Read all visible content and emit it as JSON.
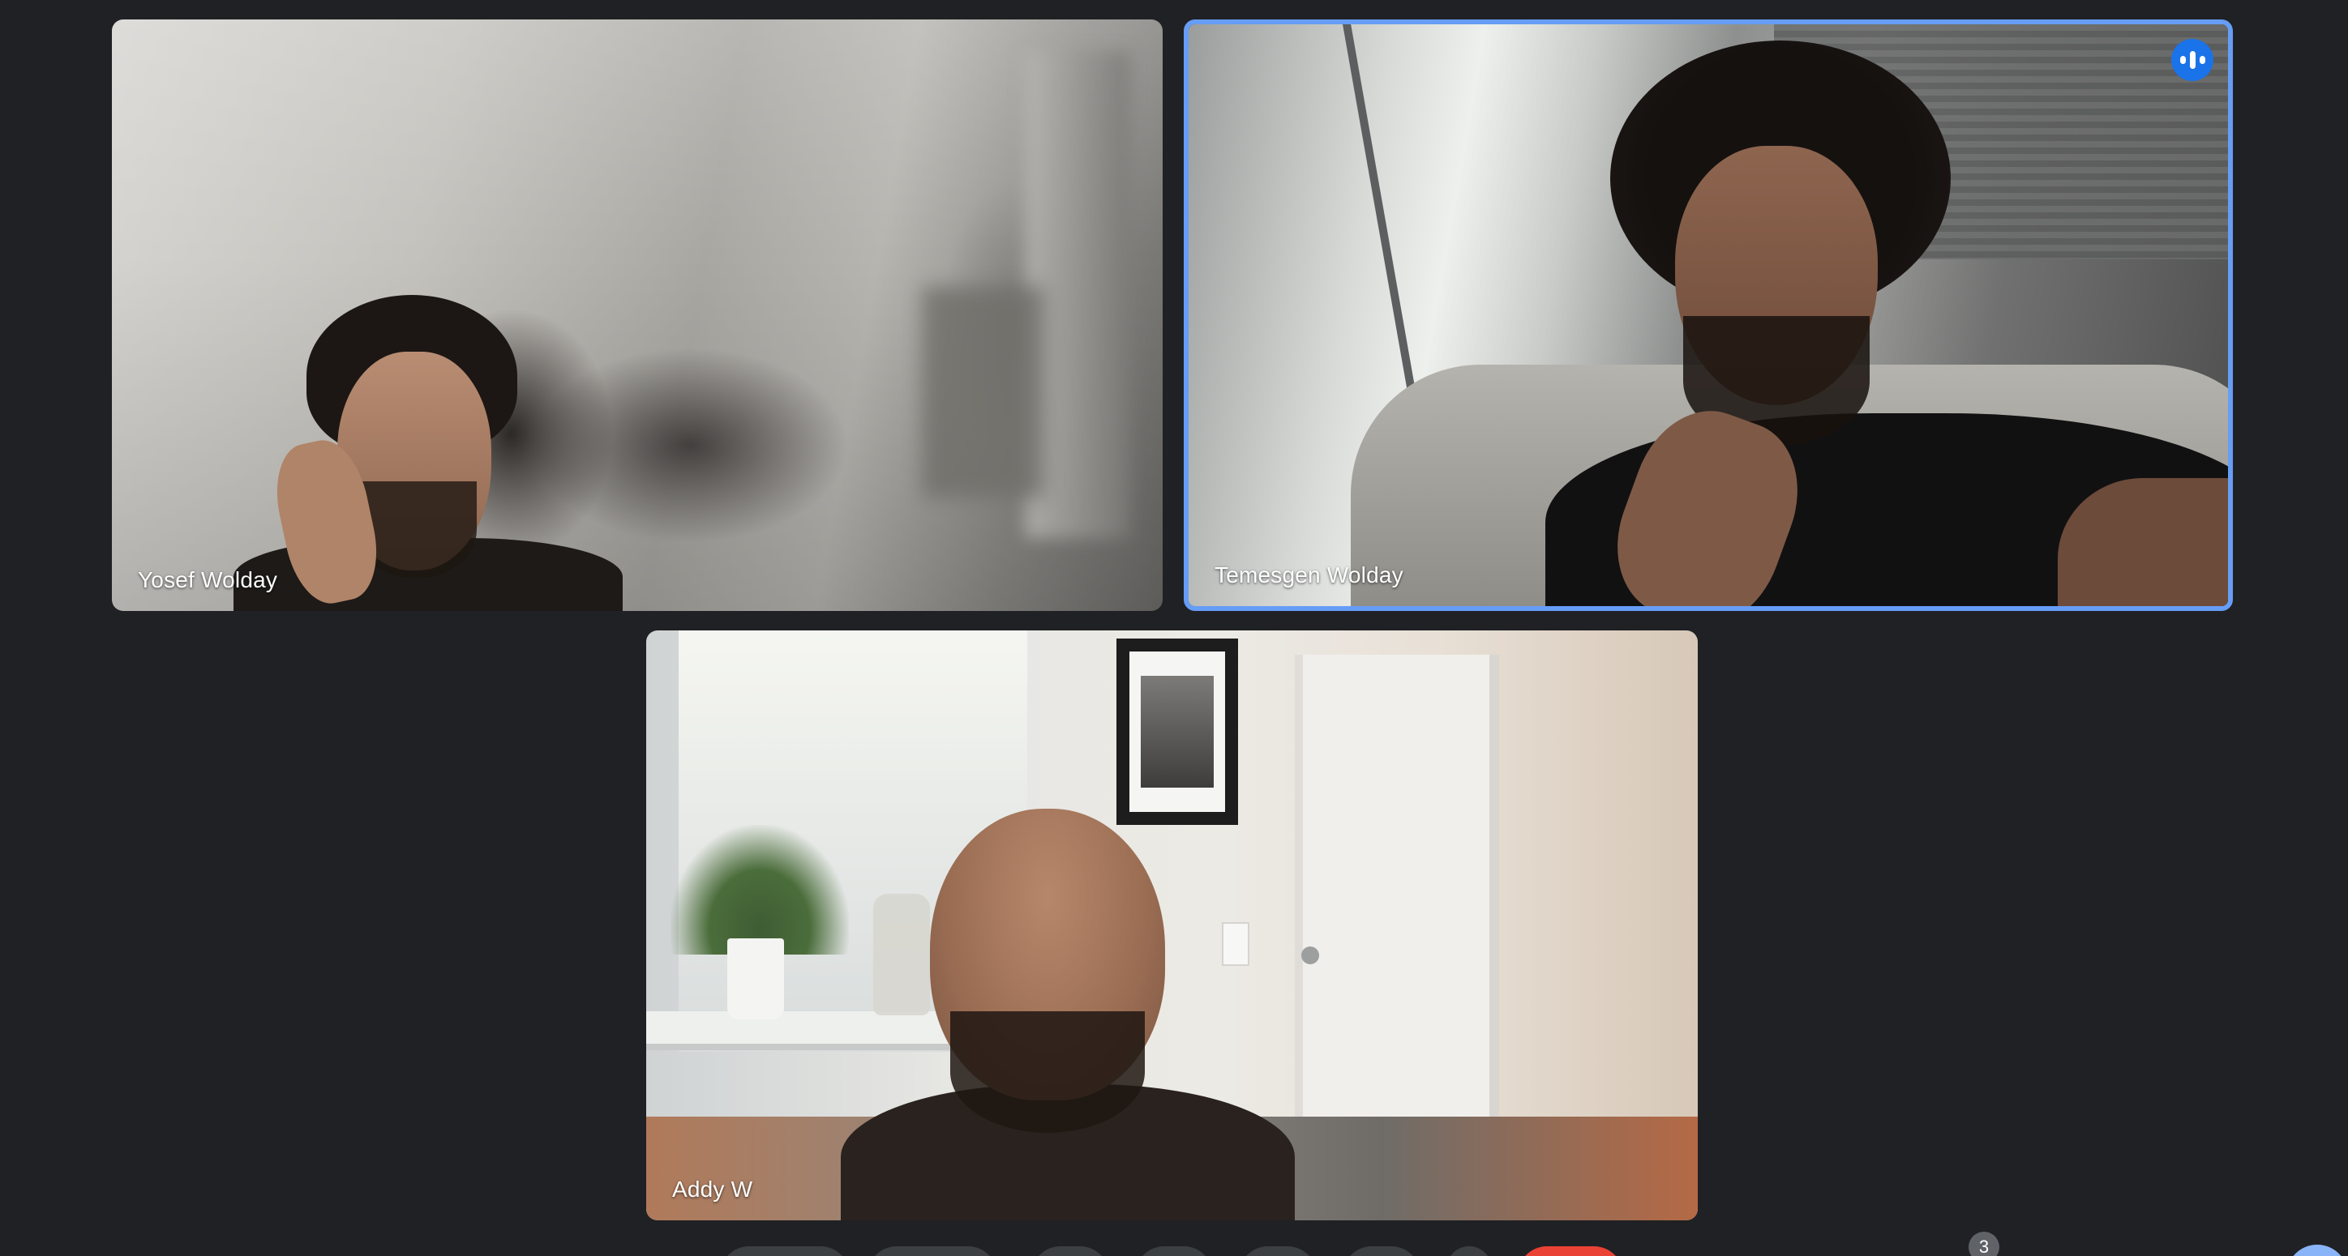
{
  "meeting": {
    "participant_count": "3"
  },
  "participants": [
    {
      "name": "Yosef Wolday",
      "speaking": false
    },
    {
      "name": "Temesgen Wolday",
      "speaking": true
    },
    {
      "name": "Addy W",
      "speaking": false
    }
  ],
  "colors": {
    "background": "#202124",
    "active_speaker_border": "#669df6",
    "speaking_indicator": "#1a73e8",
    "leave_button": "#ea4335",
    "control_button": "#3c4043"
  },
  "icons": {
    "speaking": "audio-level-icon"
  }
}
